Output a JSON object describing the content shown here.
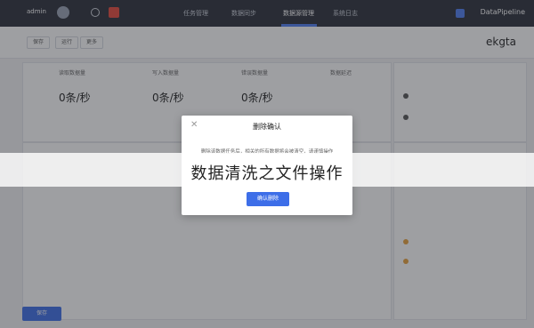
{
  "banner": {
    "title": "数据清洗之文件操作"
  },
  "topbar": {
    "brand": "DataPipeline",
    "tabs": [
      "任务管理",
      "数据同步",
      "数据源管理",
      "系统日志"
    ],
    "user": "admin"
  },
  "subhead": {
    "app_title": "ekgta",
    "buttons": [
      "保存",
      "运行",
      "更多"
    ]
  },
  "stats": [
    {
      "label": "读取数据量",
      "value": "0条/秒"
    },
    {
      "label": "写入数据量",
      "value": "0条/秒"
    },
    {
      "label": "错误数据量",
      "value": "0条/秒"
    },
    {
      "label": "数据延迟",
      "value": ""
    }
  ],
  "dialog": {
    "title": "删除确认",
    "close_icon": "close-icon",
    "message": "删除该数据任务后，相关的所有数据将会被清空，请谨慎操作",
    "confirm": "确认删除"
  },
  "footer": {
    "save": "保存"
  },
  "colors": {
    "topbar": "#2b2f3a",
    "accent": "#3d6ee8",
    "mask": "rgba(40,42,48,0.45)",
    "alert_red": "#e5483b",
    "warn_yellow": "#e8a13b"
  }
}
